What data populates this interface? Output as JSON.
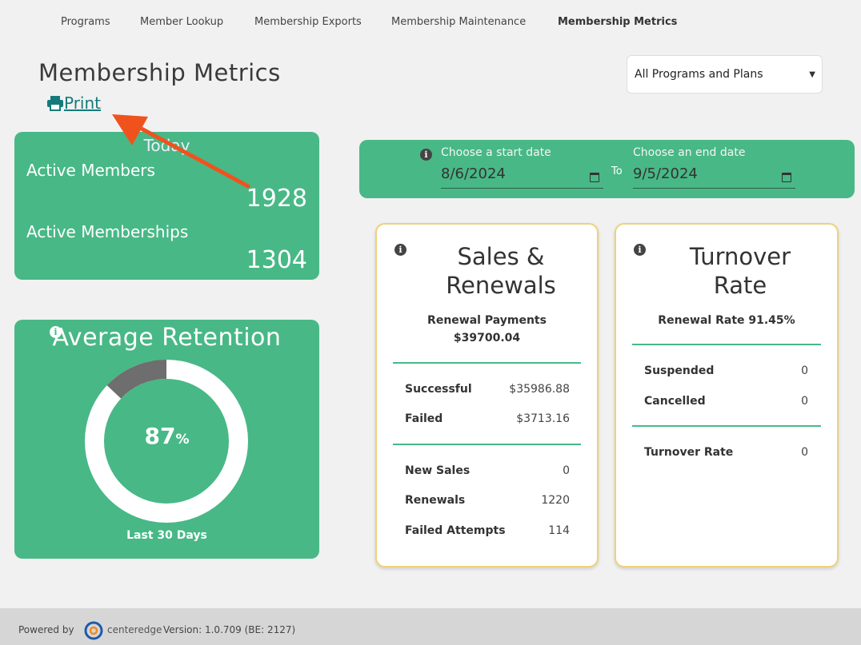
{
  "nav": {
    "items": [
      {
        "label": "Programs"
      },
      {
        "label": "Member Lookup"
      },
      {
        "label": "Membership Exports"
      },
      {
        "label": "Membership Maintenance"
      },
      {
        "label": "Membership Metrics"
      }
    ],
    "active": "Membership Metrics"
  },
  "header": {
    "title": "Membership Metrics",
    "print_label": "Print",
    "print_icon": "printer-icon"
  },
  "program_select": {
    "value": "All Programs and Plans",
    "options": [
      "All Programs and Plans"
    ]
  },
  "today": {
    "label": "Today",
    "active_members_label": "Active Members",
    "active_members_value": "1928",
    "active_memberships_label": "Active Memberships",
    "active_memberships_value": "1304"
  },
  "retention": {
    "title": "Average Retention",
    "percent": "87",
    "percent_sign": "%",
    "period": "Last 30 Days",
    "fraction": 0.87
  },
  "dates": {
    "start_label": "Choose a start date",
    "start_value": "8/6/2024",
    "to_label": "To",
    "end_label": "Choose an end date",
    "end_value": "9/5/2024"
  },
  "sales": {
    "title_line1": "Sales &",
    "title_line2": "Renewals",
    "renewal_payments_label": "Renewal Payments",
    "renewal_payments_value": "$39700.04",
    "rows_group1": [
      {
        "label": "Successful",
        "value": "$35986.88"
      },
      {
        "label": "Failed",
        "value": "$3713.16"
      }
    ],
    "rows_group2": [
      {
        "label": "New Sales",
        "value": "0"
      },
      {
        "label": "Renewals",
        "value": "1220"
      },
      {
        "label": "Failed Attempts",
        "value": "114"
      }
    ]
  },
  "turnover": {
    "title_line1": "Turnover",
    "title_line2": "Rate",
    "renewal_rate": "Renewal Rate 91.45%",
    "rows_group1": [
      {
        "label": "Suspended",
        "value": "0"
      },
      {
        "label": "Cancelled",
        "value": "0"
      }
    ],
    "rows_group2": [
      {
        "label": "Turnover Rate",
        "value": "0"
      }
    ]
  },
  "footer": {
    "powered_by": "Powered by",
    "brand": "centeredge",
    "version": "Version: 1.0.709 (BE: 2127)"
  },
  "colors": {
    "accent_green": "#48b886",
    "card_border": "#eed27a",
    "link_teal": "#157a7a",
    "annotation_arrow": "#f0521e"
  }
}
